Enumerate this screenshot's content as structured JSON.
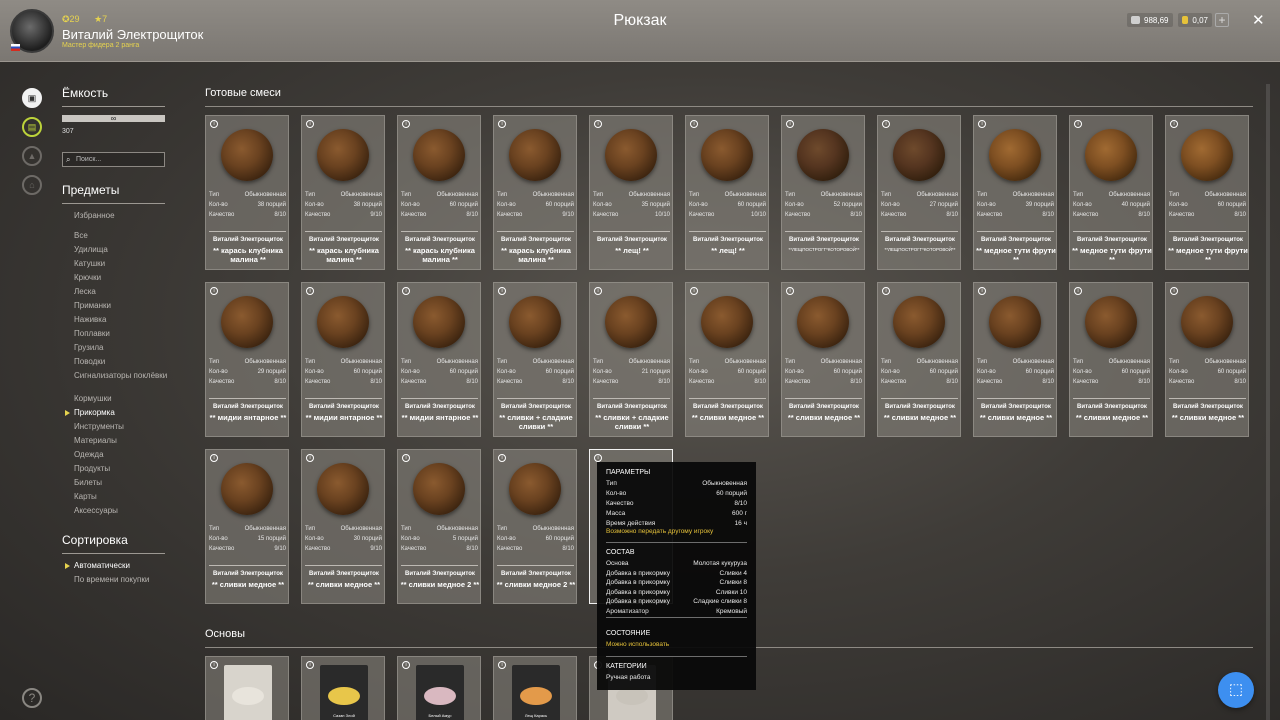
{
  "header": {
    "level": "29",
    "stars": "7",
    "player_name": "Виталий Электрощиток",
    "player_rank": "Мастер фидера 2 ранга",
    "title": "Рюкзак",
    "silver": "988,69",
    "gold": "0,07",
    "plus": "+",
    "close": "✕"
  },
  "sidebar_icons": [
    "backpack-icon",
    "baitbox-icon",
    "boat-icon",
    "house-icon"
  ],
  "left_panel": {
    "capacity_title": "Ёмкость",
    "capacity_bar_text": "∞",
    "capacity_value": "307",
    "search_placeholder": "Поиск...",
    "items_title": "Предметы",
    "items": [
      "Избранное",
      "Все",
      "Удилища",
      "Катушки",
      "Крючки",
      "Леска",
      "Приманки",
      "Наживка",
      "Поплавки",
      "Грузила",
      "Поводки",
      "Сигнализаторы поклёвки",
      "Кормушки",
      "Прикормка",
      "Инструменты",
      "Материалы",
      "Одежда",
      "Продукты",
      "Билеты",
      "Карты",
      "Аксессуары"
    ],
    "active_item": "Прикормка",
    "sort_title": "Сортировка",
    "sort_items": [
      "Автоматически",
      "По времени покупки"
    ]
  },
  "content": {
    "ready_mixes_title": "Готовые смеси",
    "bases_title": "Основы",
    "field_labels": {
      "type": "Тип",
      "qty": "Кол-во",
      "quality": "Качество"
    },
    "author": "Виталий Электрощиток",
    "cards": [
      {
        "type": "Обыкновенная",
        "qty": "38 порций",
        "quality": "8/10",
        "name": "** карась клубника малина **"
      },
      {
        "type": "Обыкновенная",
        "qty": "38 порций",
        "quality": "9/10",
        "name": "** карась клубника малина **"
      },
      {
        "type": "Обыкновенная",
        "qty": "60 порций",
        "quality": "8/10",
        "name": "** карась клубника малина **"
      },
      {
        "type": "Обыкновенная",
        "qty": "60 порций",
        "quality": "9/10",
        "name": "** карась клубника малина **"
      },
      {
        "type": "Обыкновенная",
        "qty": "35 порций",
        "quality": "10/10",
        "name": "** лещ! **"
      },
      {
        "type": "Обыкновенная",
        "qty": "60 порций",
        "quality": "10/10",
        "name": "** лещ! **"
      },
      {
        "type": "Обыкновенная",
        "qty": "52 порции",
        "quality": "8/10",
        "name": "**ЛЕЩПОСТРОГГ*КОТОРОВОЙ**",
        "tiny": true
      },
      {
        "type": "Обыкновенная",
        "qty": "27 порций",
        "quality": "8/10",
        "name": "**ЛЕЩПОСТРОГГ*КОТОРОВОЙ**",
        "tiny": true
      },
      {
        "type": "Обыкновенная",
        "qty": "39 порций",
        "quality": "8/10",
        "name": "** медное тути фрути **"
      },
      {
        "type": "Обыкновенная",
        "qty": "40 порций",
        "quality": "8/10",
        "name": "** медное тути фрути **"
      },
      {
        "type": "Обыкновенная",
        "qty": "60 порций",
        "quality": "8/10",
        "name": "** медное тути фрути **"
      },
      {
        "type": "Обыкновенная",
        "qty": "29 порций",
        "quality": "8/10",
        "name": "** мидии янтарное **"
      },
      {
        "type": "Обыкновенная",
        "qty": "60 порций",
        "quality": "8/10",
        "name": "** мидии янтарное **"
      },
      {
        "type": "Обыкновенная",
        "qty": "60 порций",
        "quality": "8/10",
        "name": "** мидии янтарное **"
      },
      {
        "type": "Обыкновенная",
        "qty": "60 порций",
        "quality": "8/10",
        "name": "** сливки + сладкие сливки **"
      },
      {
        "type": "Обыкновенная",
        "qty": "21 порция",
        "quality": "8/10",
        "name": "** сливки + сладкие сливки **"
      },
      {
        "type": "Обыкновенная",
        "qty": "60 порций",
        "quality": "8/10",
        "name": "** сливки медное **"
      },
      {
        "type": "Обыкновенная",
        "qty": "60 порций",
        "quality": "8/10",
        "name": "** сливки медное **"
      },
      {
        "type": "Обыкновенная",
        "qty": "60 порций",
        "quality": "8/10",
        "name": "** сливки медное **"
      },
      {
        "type": "Обыкновенная",
        "qty": "60 порций",
        "quality": "8/10",
        "name": "** сливки медное **"
      },
      {
        "type": "Обыкновенная",
        "qty": "60 порций",
        "quality": "8/10",
        "name": "** сливки медное **"
      },
      {
        "type": "Обыкновенная",
        "qty": "60 порций",
        "quality": "8/10",
        "name": "** сливки медное **"
      },
      {
        "type": "Обыкновенная",
        "qty": "15 порций",
        "quality": "9/10",
        "name": "** сливки медное **"
      },
      {
        "type": "Обыкновенная",
        "qty": "30 порций",
        "quality": "9/10",
        "name": "** сливки медное **"
      },
      {
        "type": "Обыкновенная",
        "qty": "5 порций",
        "quality": "8/10",
        "name": "** сливки медное 2 **"
      },
      {
        "type": "Обыкновенная",
        "qty": "60 порций",
        "quality": "8/10",
        "name": "** сливки медное 2 **"
      }
    ],
    "bases": [
      {
        "label": ""
      },
      {
        "label": "Сазан Злой"
      },
      {
        "label": "Белый Амур"
      },
      {
        "label": "Лещ Карась"
      },
      {
        "label": ""
      }
    ]
  },
  "tooltip": {
    "params_title": "ПАРАМЕТРЫ",
    "params": [
      {
        "k": "Тип",
        "v": "Обыкновенная"
      },
      {
        "k": "Кол-во",
        "v": "60 порций"
      },
      {
        "k": "Качество",
        "v": "8/10"
      },
      {
        "k": "Масса",
        "v": "600 г"
      },
      {
        "k": "Время действия",
        "v": "16 ч"
      }
    ],
    "transfer_note": "Возможно передать другому игроку",
    "composition_title": "СОСТАВ",
    "composition": [
      {
        "k": "Основа",
        "v": "Молотая кукуруза"
      },
      {
        "k": "Добавка в прикормку",
        "v": "Сливки 4"
      },
      {
        "k": "Добавка в прикормку",
        "v": "Сливки 8"
      },
      {
        "k": "Добавка в прикормку",
        "v": "Сливки 10"
      },
      {
        "k": "Добавка в прикормку",
        "v": "Сладкие сливки 8"
      },
      {
        "k": "Ароматизатор",
        "v": "Кремовый"
      }
    ],
    "state_title": "СОСТОЯНИЕ",
    "state_value": "Можно использовать",
    "category_title": "КАТЕГОРИИ",
    "category_value": "Ручная работа"
  },
  "help": "?",
  "colors": {
    "accent": "#e6d34f",
    "tooltip_note": "#e6c23a",
    "fab": "#3d8ff0"
  }
}
